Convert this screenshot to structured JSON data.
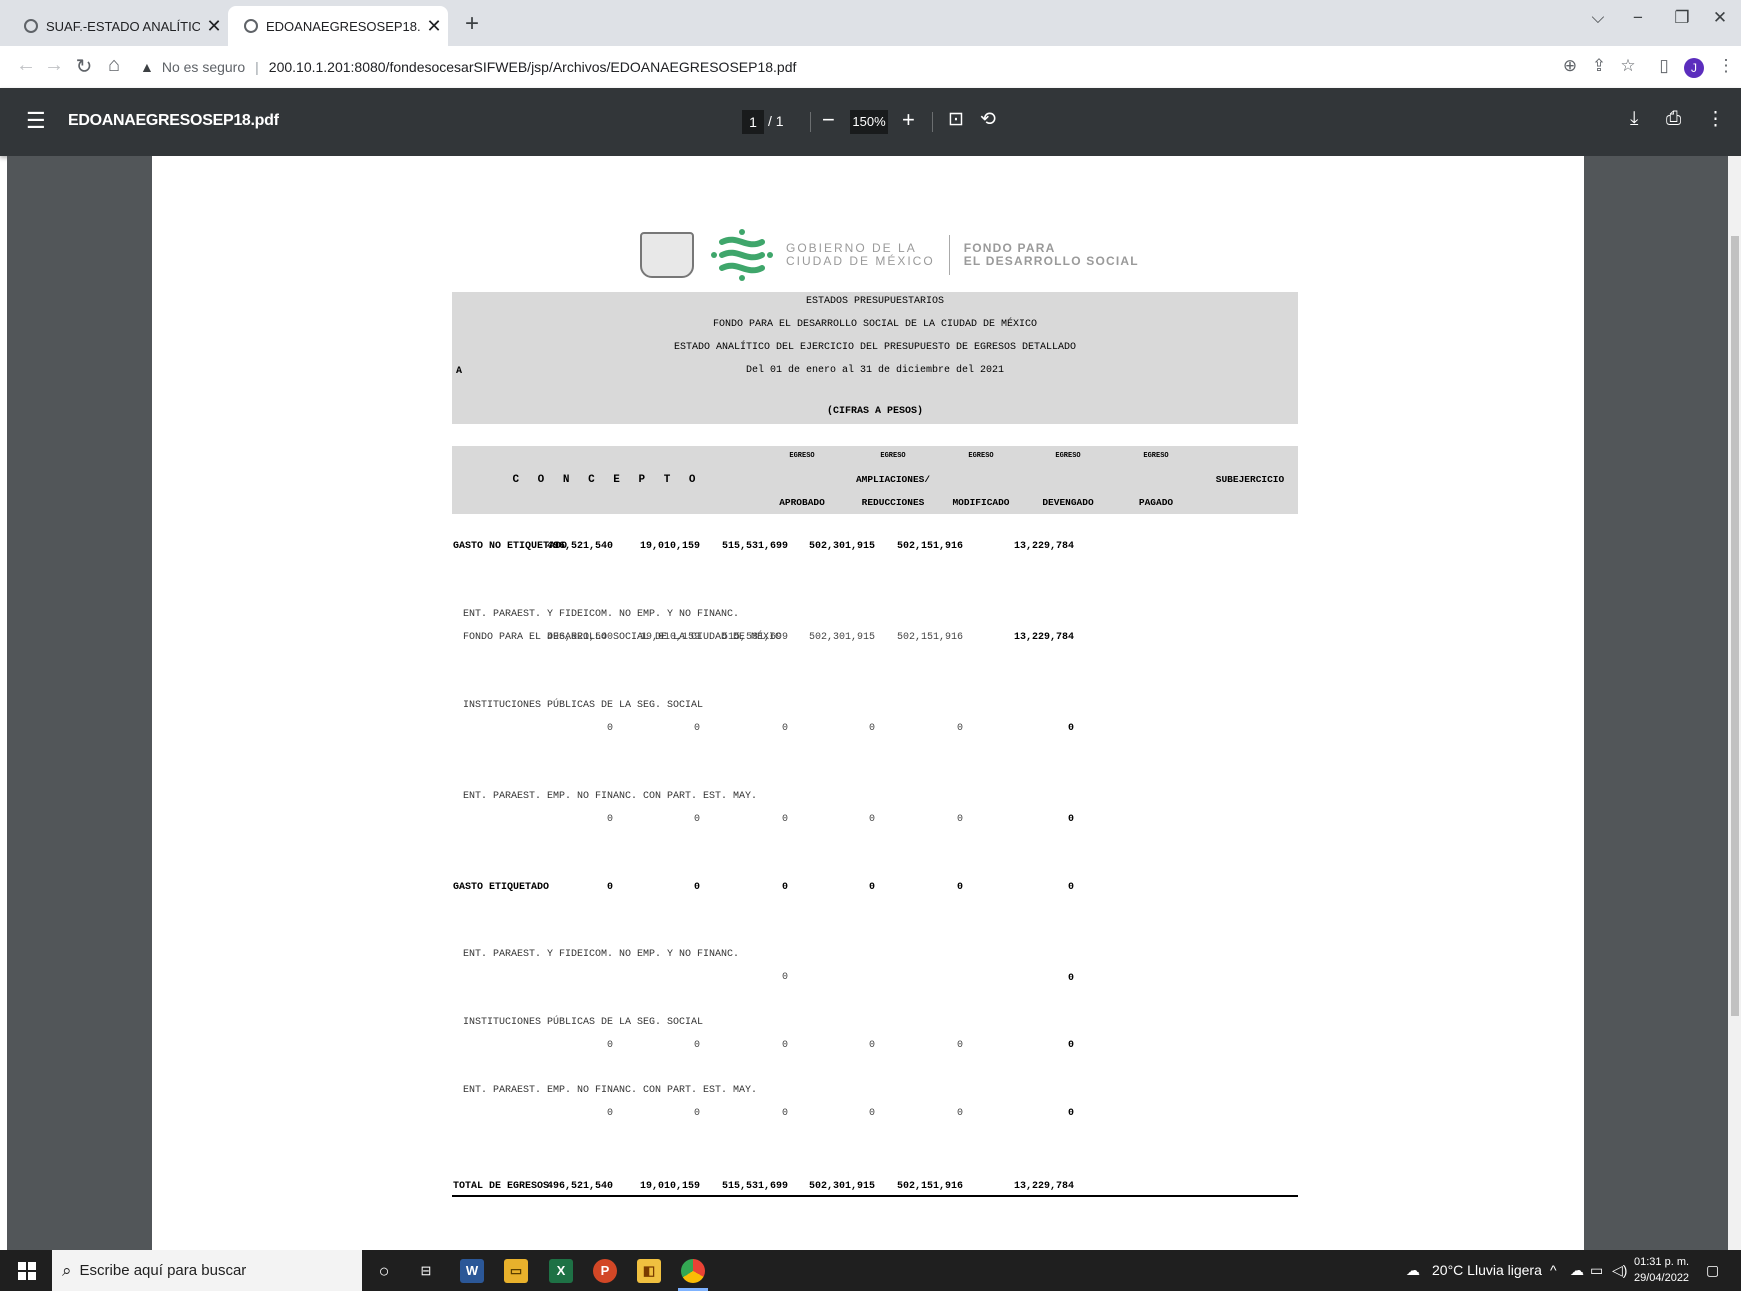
{
  "browser": {
    "tabs": [
      {
        "title": "SUAF.-ESTADO ANALÍTICO DEL E",
        "active": false
      },
      {
        "title": "EDOANAEGRESOSEP18.pdf",
        "active": true
      }
    ],
    "security_label": "No es seguro",
    "url": "200.10.1.201:8080/fondesocesarSIFWEB/jsp/Archivos/EDOANAEGRESOSEP18.pdf",
    "profile_initial": "J"
  },
  "pdf_toolbar": {
    "file_name": "EDOANAEGRESOSEP18.pdf",
    "current_page": "1",
    "total_pages": "/ 1",
    "zoom": "150%"
  },
  "document": {
    "logo": {
      "line1": "GOBIERNO DE LA",
      "line2": "CIUDAD DE MÉXICO",
      "line3": "FONDO PARA",
      "line4": "EL DESARROLLO SOCIAL"
    },
    "header": {
      "line1": "ESTADOS PRESUPUESTARIOS",
      "line2": "FONDO PARA EL DESARROLLO SOCIAL DE LA CIUDAD DE MÉXICO",
      "line3": "ESTADO ANALÍTICO DEL EJERCICIO DEL PRESUPUESTO DE EGRESOS DETALLADO",
      "line4": "Del 01 de enero al 31 de diciembre del 2021",
      "line5": "(CIFRAS A PESOS)",
      "mark": "A"
    },
    "columns": {
      "concepto": "C O N C E P T O",
      "top": [
        "EGRESO",
        "EGRESO",
        "EGRESO",
        "EGRESO",
        "EGRESO"
      ],
      "mid_ampliaciones": "AMPLIACIONES/",
      "bottom": [
        "APROBADO",
        "REDUCCIONES",
        "MODIFICADO",
        "DEVENGADO",
        "PAGADO",
        "SUBEJERCICIO"
      ]
    },
    "rows": [
      {
        "label": "GASTO NO ETIQUETADO",
        "values": [
          "496,521,540",
          "19,010,159",
          "515,531,699",
          "502,301,915",
          "502,151,916",
          "13,229,784"
        ]
      },
      {
        "label": "ENT. PARAEST. Y FIDEICOM. NO EMP. Y NO FINANC."
      },
      {
        "label": "FONDO PARA EL DESARROLLO SOCIAL DE LA CIUDAD DE MÉXIC",
        "values": [
          "496,521,540",
          "19,010,159",
          "515,531,699",
          "502,301,915",
          "502,151,916",
          "13,229,784"
        ]
      },
      {
        "label": "INSTITUCIONES PÚBLICAS DE LA SEG. SOCIAL",
        "values": [
          "0",
          "0",
          "0",
          "0",
          "0",
          "0"
        ]
      },
      {
        "label": "ENT. PARAEST. EMP. NO FINANC. CON PART. EST. MAY.",
        "values": [
          "0",
          "0",
          "0",
          "0",
          "0",
          "0"
        ]
      },
      {
        "label": "GASTO ETIQUETADO",
        "values": [
          "0",
          "0",
          "0",
          "0",
          "0",
          "0"
        ]
      },
      {
        "label": "ENT. PARAEST. Y FIDEICOM. NO EMP. Y NO FINANC.",
        "values": [
          "0",
          "0"
        ]
      },
      {
        "label": "INSTITUCIONES PÚBLICAS DE LA SEG. SOCIAL",
        "values": [
          "0",
          "0",
          "0",
          "0",
          "0",
          "0"
        ]
      },
      {
        "label": "ENT. PARAEST. EMP. NO FINANC. CON PART. EST. MAY.",
        "values": [
          "0",
          "0",
          "0",
          "0",
          "0",
          "0"
        ]
      },
      {
        "label": "TOTAL DE EGRESOS",
        "values": [
          "496,521,540",
          "19,010,159",
          "515,531,699",
          "502,301,915",
          "502,151,916",
          "13,229,784"
        ]
      }
    ]
  },
  "taskbar": {
    "search_placeholder": "Escribe aquí para buscar",
    "weather": "20°C  Lluvia ligera",
    "time": "01:31 p. m.",
    "date": "29/04/2022",
    "apps": [
      "W",
      "X",
      "P"
    ]
  }
}
